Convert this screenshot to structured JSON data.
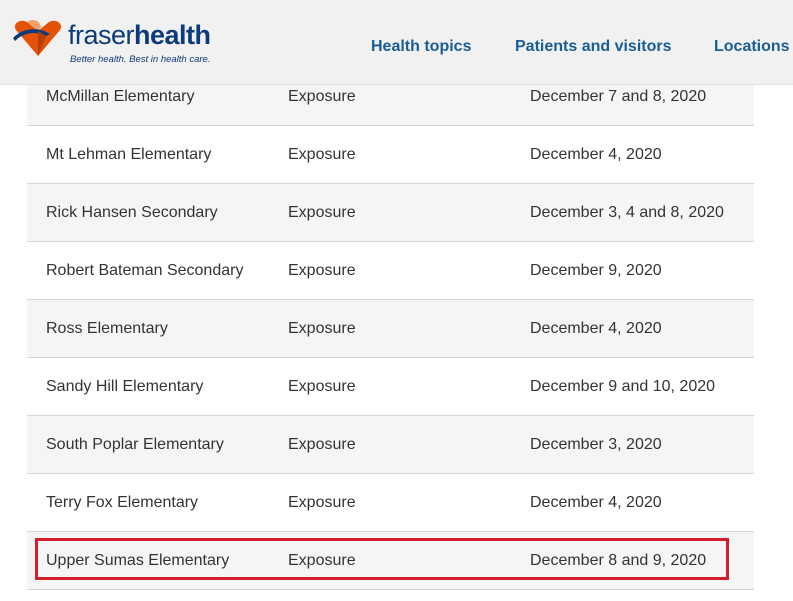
{
  "header": {
    "logo": {
      "word_light": "fraser",
      "word_bold": "health",
      "tagline": "Better health. Best in health care."
    },
    "nav": [
      {
        "label": "Health topics"
      },
      {
        "label": "Patients and visitors"
      },
      {
        "label": "Locations"
      }
    ]
  },
  "colors": {
    "brand_blue": "#0b3b7c",
    "brand_orange": "#e35205",
    "nav_blue": "#1a5d94",
    "highlight_red": "#d21f2b"
  },
  "exposures": {
    "rows": [
      {
        "school": "McMillan Elementary",
        "type": "Exposure",
        "date": "December 7 and 8, 2020"
      },
      {
        "school": "Mt Lehman Elementary",
        "type": "Exposure",
        "date": "December 4, 2020"
      },
      {
        "school": "Rick Hansen Secondary",
        "type": "Exposure",
        "date": "December 3, 4 and 8, 2020"
      },
      {
        "school": "Robert Bateman Secondary",
        "type": "Exposure",
        "date": "December 9, 2020"
      },
      {
        "school": "Ross Elementary",
        "type": "Exposure",
        "date": "December 4, 2020"
      },
      {
        "school": "Sandy Hill Elementary",
        "type": "Exposure",
        "date": "December 9 and 10, 2020"
      },
      {
        "school": "South Poplar Elementary",
        "type": "Exposure",
        "date": "December 3, 2020"
      },
      {
        "school": "Terry Fox Elementary",
        "type": "Exposure",
        "date": "December 4, 2020"
      },
      {
        "school": "Upper Sumas Elementary",
        "type": "Exposure",
        "date": "December 8 and 9, 2020"
      }
    ]
  }
}
